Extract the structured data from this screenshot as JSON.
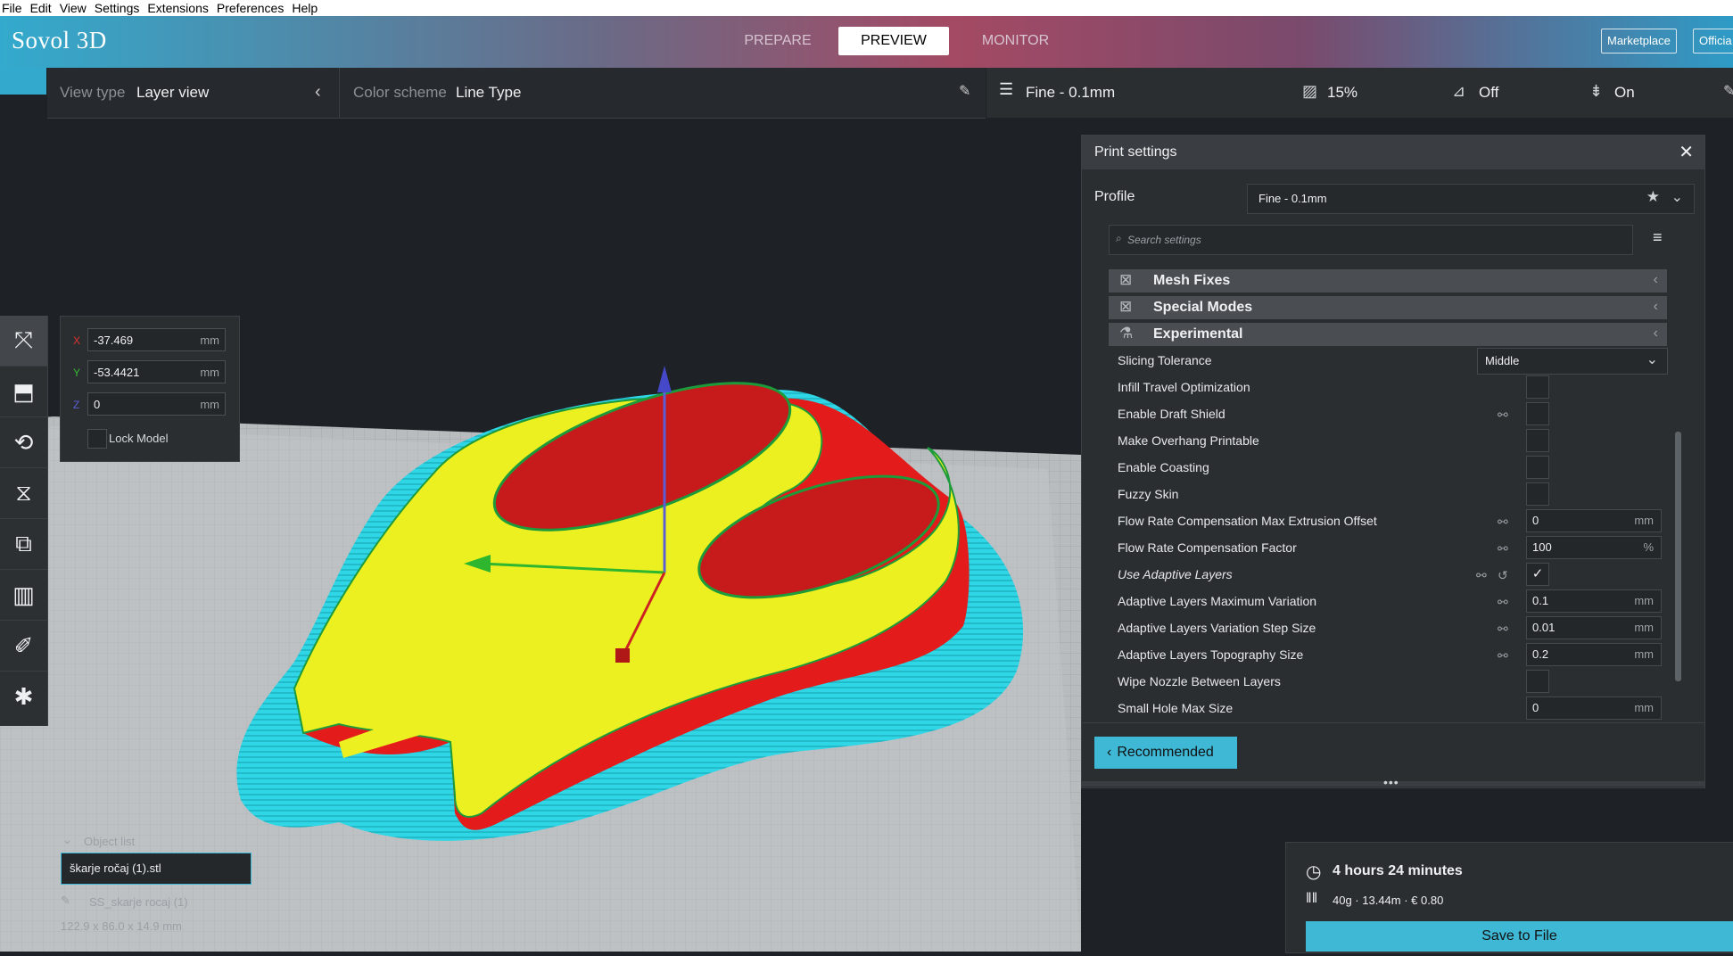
{
  "menu": [
    "File",
    "Edit",
    "View",
    "Settings",
    "Extensions",
    "Preferences",
    "Help"
  ],
  "brand": "Sovol 3D",
  "stages": [
    "PREPARE",
    "PREVIEW",
    "MONITOR"
  ],
  "header_buttons": {
    "marketplace": "Marketplace",
    "official": "Officia"
  },
  "viewbar": {
    "view_type_label": "View type",
    "view_type_value": "Layer view",
    "color_scheme_label": "Color scheme",
    "color_scheme_value": "Line Type"
  },
  "summary": {
    "profile": "Fine - 0.1mm",
    "infill": "15%",
    "support": "Off",
    "adhesion": "On"
  },
  "move": {
    "x_label": "X",
    "x": "-37.469",
    "y_label": "Y",
    "y": "-53.4421",
    "z_label": "Z",
    "z": "0",
    "unit": "mm",
    "lock": "Lock Model"
  },
  "print_settings": {
    "title": "Print settings",
    "profile_label": "Profile",
    "profile_value": "Fine - 0.1mm",
    "search_placeholder": "Search settings",
    "categories": [
      "Mesh Fixes",
      "Special Modes",
      "Experimental"
    ],
    "slicing_tolerance": {
      "label": "Slicing Tolerance",
      "value": "Middle"
    },
    "rows": [
      {
        "label": "Infill Travel Optimization"
      },
      {
        "label": "Enable Draft Shield"
      },
      {
        "label": "Make Overhang Printable"
      },
      {
        "label": "Enable Coasting"
      },
      {
        "label": "Fuzzy Skin"
      },
      {
        "label": "Flow Rate Compensation Max Extrusion Offset",
        "value": "0",
        "unit": "mm"
      },
      {
        "label": "Flow Rate Compensation Factor",
        "value": "100",
        "unit": "%"
      },
      {
        "label": "Use Adaptive Layers",
        "value": "✓"
      },
      {
        "label": "Adaptive Layers Maximum Variation",
        "value": "0.1",
        "unit": "mm"
      },
      {
        "label": "Adaptive Layers Variation Step Size",
        "value": "0.01",
        "unit": "mm"
      },
      {
        "label": "Adaptive Layers Topography Size",
        "value": "0.2",
        "unit": "mm"
      },
      {
        "label": "Wipe Nozzle Between Layers"
      },
      {
        "label": "Small Hole Max Size",
        "value": "0",
        "unit": "mm"
      }
    ],
    "recommended": "Recommended"
  },
  "object_list": {
    "title": "Object list",
    "file": "škarje ročaj (1).stl",
    "object": "SS_skarje rocaj (1)",
    "dims": "122.9 x 86.0 x 14.9 mm"
  },
  "job": {
    "time": "4 hours 24 minutes",
    "material": "40g · 13.44m · € 0.80",
    "save": "Save to File"
  }
}
